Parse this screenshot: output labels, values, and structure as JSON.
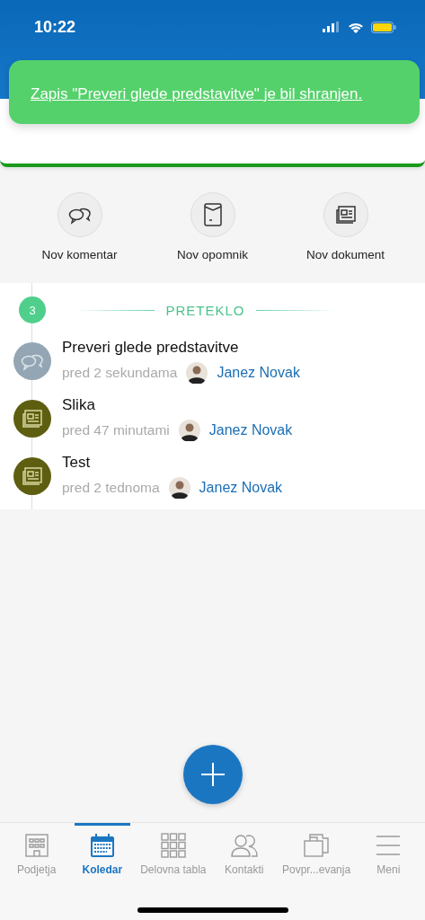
{
  "status_bar": {
    "time": "10:22"
  },
  "toast": {
    "message": "Zapis \"Preveri glede predstavitve\" je bil shranjen."
  },
  "actions": [
    {
      "kind": "comment",
      "label": "Nov komentar"
    },
    {
      "kind": "reminder",
      "label": "Nov opomnik"
    },
    {
      "kind": "document",
      "label": "Nov dokument"
    }
  ],
  "timeline": {
    "count": "3",
    "section": "PRETEKLO",
    "entries": [
      {
        "kind": "comment",
        "color": "#94a6b4",
        "title": "Preveri glede predstavitve",
        "time": "pred 2 sekundama",
        "author": "Janez Novak"
      },
      {
        "kind": "document",
        "color": "#5e5e10",
        "title": "Slika",
        "time": "pred 47 minutami",
        "author": "Janez Novak"
      },
      {
        "kind": "document",
        "color": "#5e5e10",
        "title": "Test",
        "time": "pred 2 tednoma",
        "author": "Janez Novak"
      }
    ]
  },
  "tab_bar": [
    {
      "kind": "companies",
      "label": "Podjetja",
      "selected": false
    },
    {
      "kind": "calendar",
      "label": "Koledar",
      "selected": true
    },
    {
      "kind": "dashboard",
      "label": "Delovna tabla",
      "selected": false
    },
    {
      "kind": "contacts",
      "label": "Kontakti",
      "selected": false
    },
    {
      "kind": "inquiries",
      "label": "Povpr...evanja",
      "selected": false
    },
    {
      "kind": "menu",
      "label": "Meni",
      "selected": false
    }
  ]
}
